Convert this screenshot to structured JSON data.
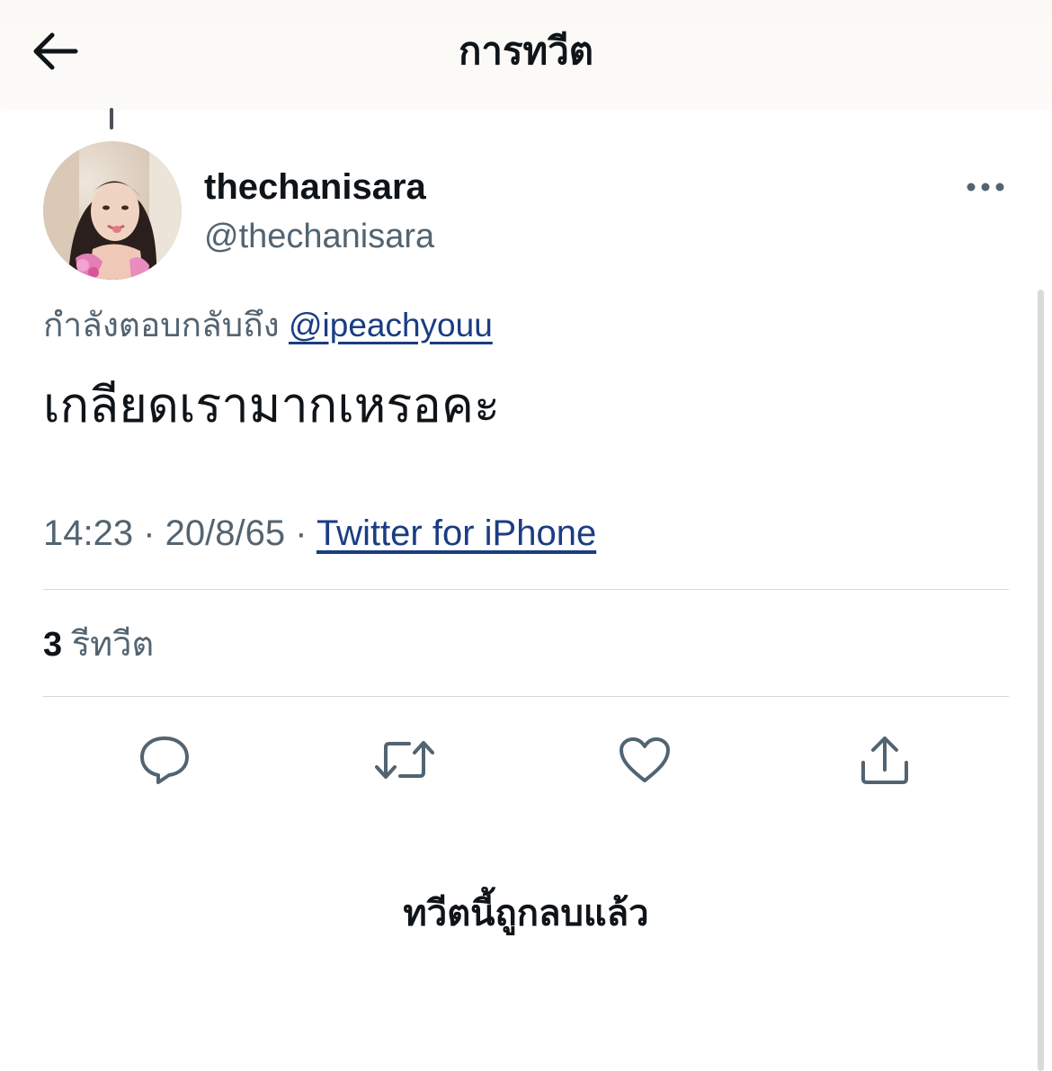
{
  "header": {
    "title": "การทวีต",
    "back_icon": "arrow-left-icon"
  },
  "tweet": {
    "author": {
      "display_name": "thechanisara",
      "handle": "@thechanisara"
    },
    "reply_prefix": "กำลังตอบกลับถึง",
    "reply_to": "@ipeachyouu",
    "text": "เกลียดเรามากเหรอคะ",
    "time": "14:23",
    "separator": " · ",
    "date": "20/8/65",
    "source": "Twitter for iPhone",
    "retweet_count": "3",
    "retweet_label": "รีทวีต"
  },
  "actions": [
    {
      "name": "reply",
      "icon": "reply-icon"
    },
    {
      "name": "retweet",
      "icon": "retweet-icon"
    },
    {
      "name": "like",
      "icon": "heart-icon"
    },
    {
      "name": "share",
      "icon": "share-icon"
    }
  ],
  "deleted_notice": "ทวีตนี้ถูกลบแล้ว",
  "colors": {
    "text_primary": "#0f1419",
    "text_secondary": "#536471",
    "link": "#1a3d82",
    "divider": "#d4d9dd"
  }
}
